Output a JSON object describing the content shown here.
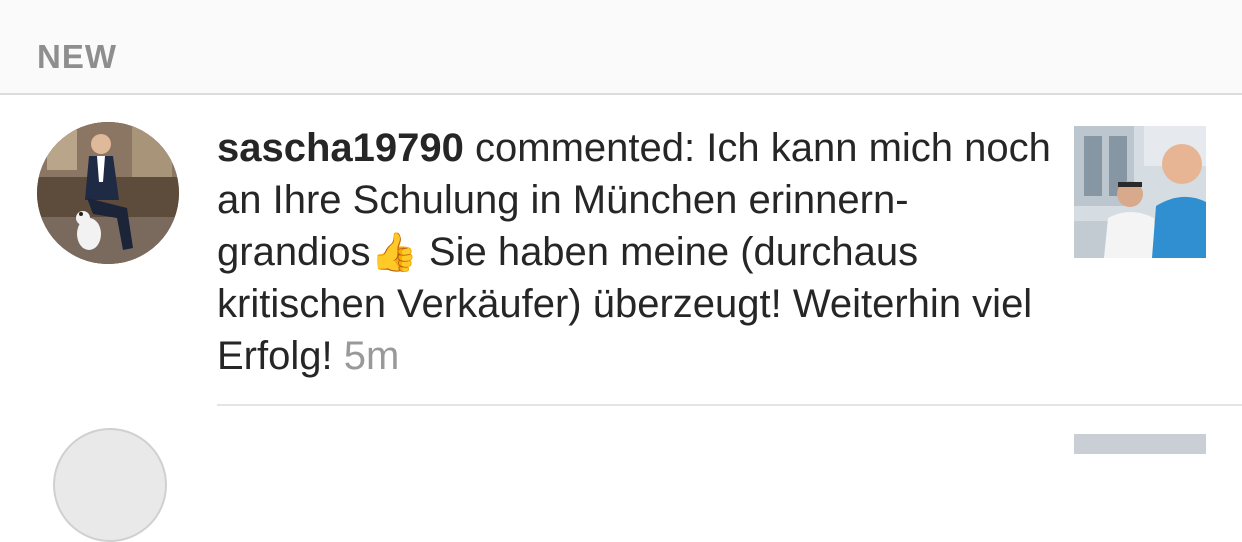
{
  "section": {
    "title": "NEW"
  },
  "notification": {
    "username": "sascha19790",
    "action": "commented:",
    "comment_text": "Ich kann mich noch an Ihre Schulung in München erinnern- grandios",
    "emoji": "👍",
    "comment_text_2": "Sie haben meine (durchaus kritischen Verkäufer) überzeugt! Weiterhin viel Erfolg!",
    "timestamp": "5m"
  }
}
